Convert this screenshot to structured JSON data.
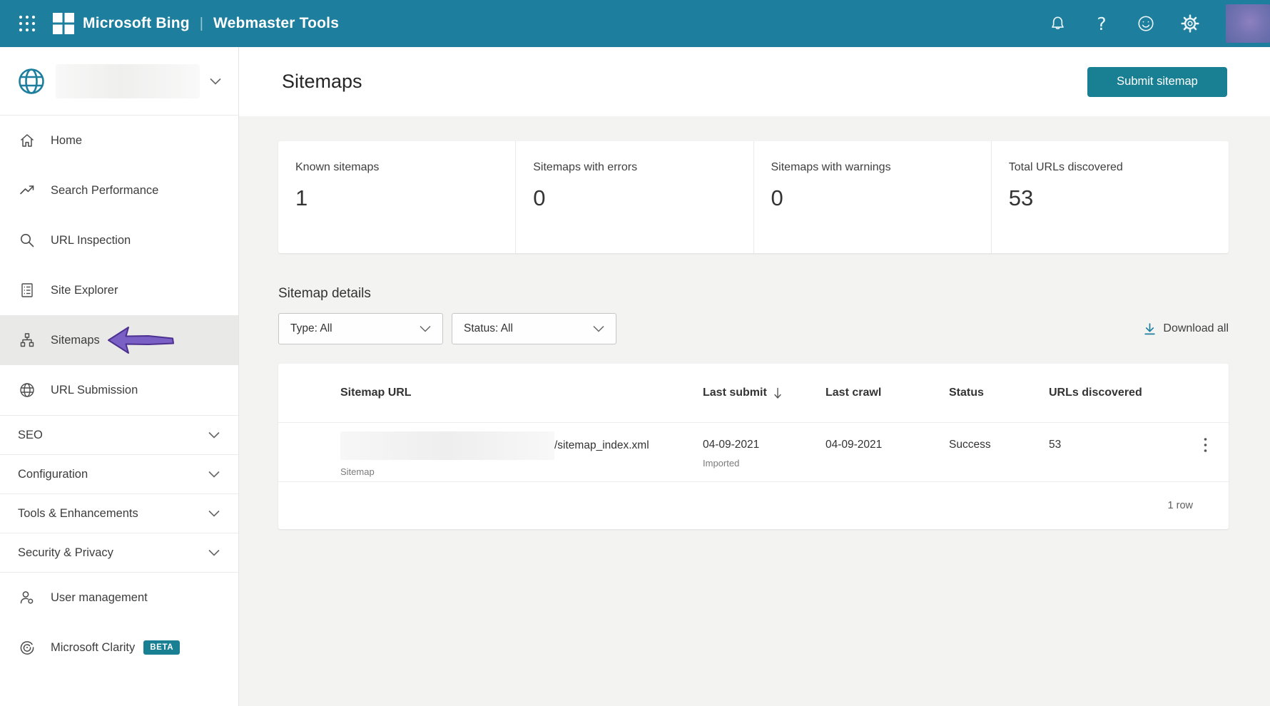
{
  "topbar": {
    "brand": "Microsoft Bing",
    "divider": "|",
    "product": "Webmaster Tools",
    "help_glyph": "?"
  },
  "sidebar": {
    "items": [
      {
        "label": "Home"
      },
      {
        "label": "Search Performance"
      },
      {
        "label": "URL Inspection"
      },
      {
        "label": "Site Explorer"
      },
      {
        "label": "Sitemaps",
        "active": true
      },
      {
        "label": "URL Submission"
      },
      {
        "label": "SEO",
        "collapsible": true
      },
      {
        "label": "Configuration",
        "collapsible": true
      },
      {
        "label": "Tools & Enhancements",
        "collapsible": true
      },
      {
        "label": "Security & Privacy",
        "collapsible": true
      },
      {
        "label": "User management"
      },
      {
        "label": "Microsoft Clarity",
        "badge": "BETA"
      }
    ]
  },
  "page": {
    "title": "Sitemaps",
    "submit_button": "Submit sitemap"
  },
  "stats": [
    {
      "label": "Known sitemaps",
      "value": "1"
    },
    {
      "label": "Sitemaps with errors",
      "value": "0"
    },
    {
      "label": "Sitemaps with warnings",
      "value": "0"
    },
    {
      "label": "Total URLs discovered",
      "value": "53"
    }
  ],
  "details": {
    "heading": "Sitemap details",
    "type_filter": "Type: All",
    "status_filter": "Status: All",
    "download_all": "Download all"
  },
  "table": {
    "columns": [
      "Sitemap URL",
      "Last submit",
      "Last crawl",
      "Status",
      "URLs discovered"
    ],
    "rows": [
      {
        "url_suffix": "/sitemap_index.xml",
        "type_label": "Sitemap",
        "last_submit": "04-09-2021",
        "last_submit_detail": "Imported",
        "last_crawl": "04-09-2021",
        "status": "Success",
        "urls_discovered": "53"
      }
    ],
    "footer": "1 row"
  },
  "colors": {
    "topbar": "#1d7f9d",
    "accent_button": "#197f92",
    "annotation_arrow": "#7a5fc5",
    "active_item_bg": "#e9e9e7",
    "content_bg": "#f3f3f2"
  }
}
